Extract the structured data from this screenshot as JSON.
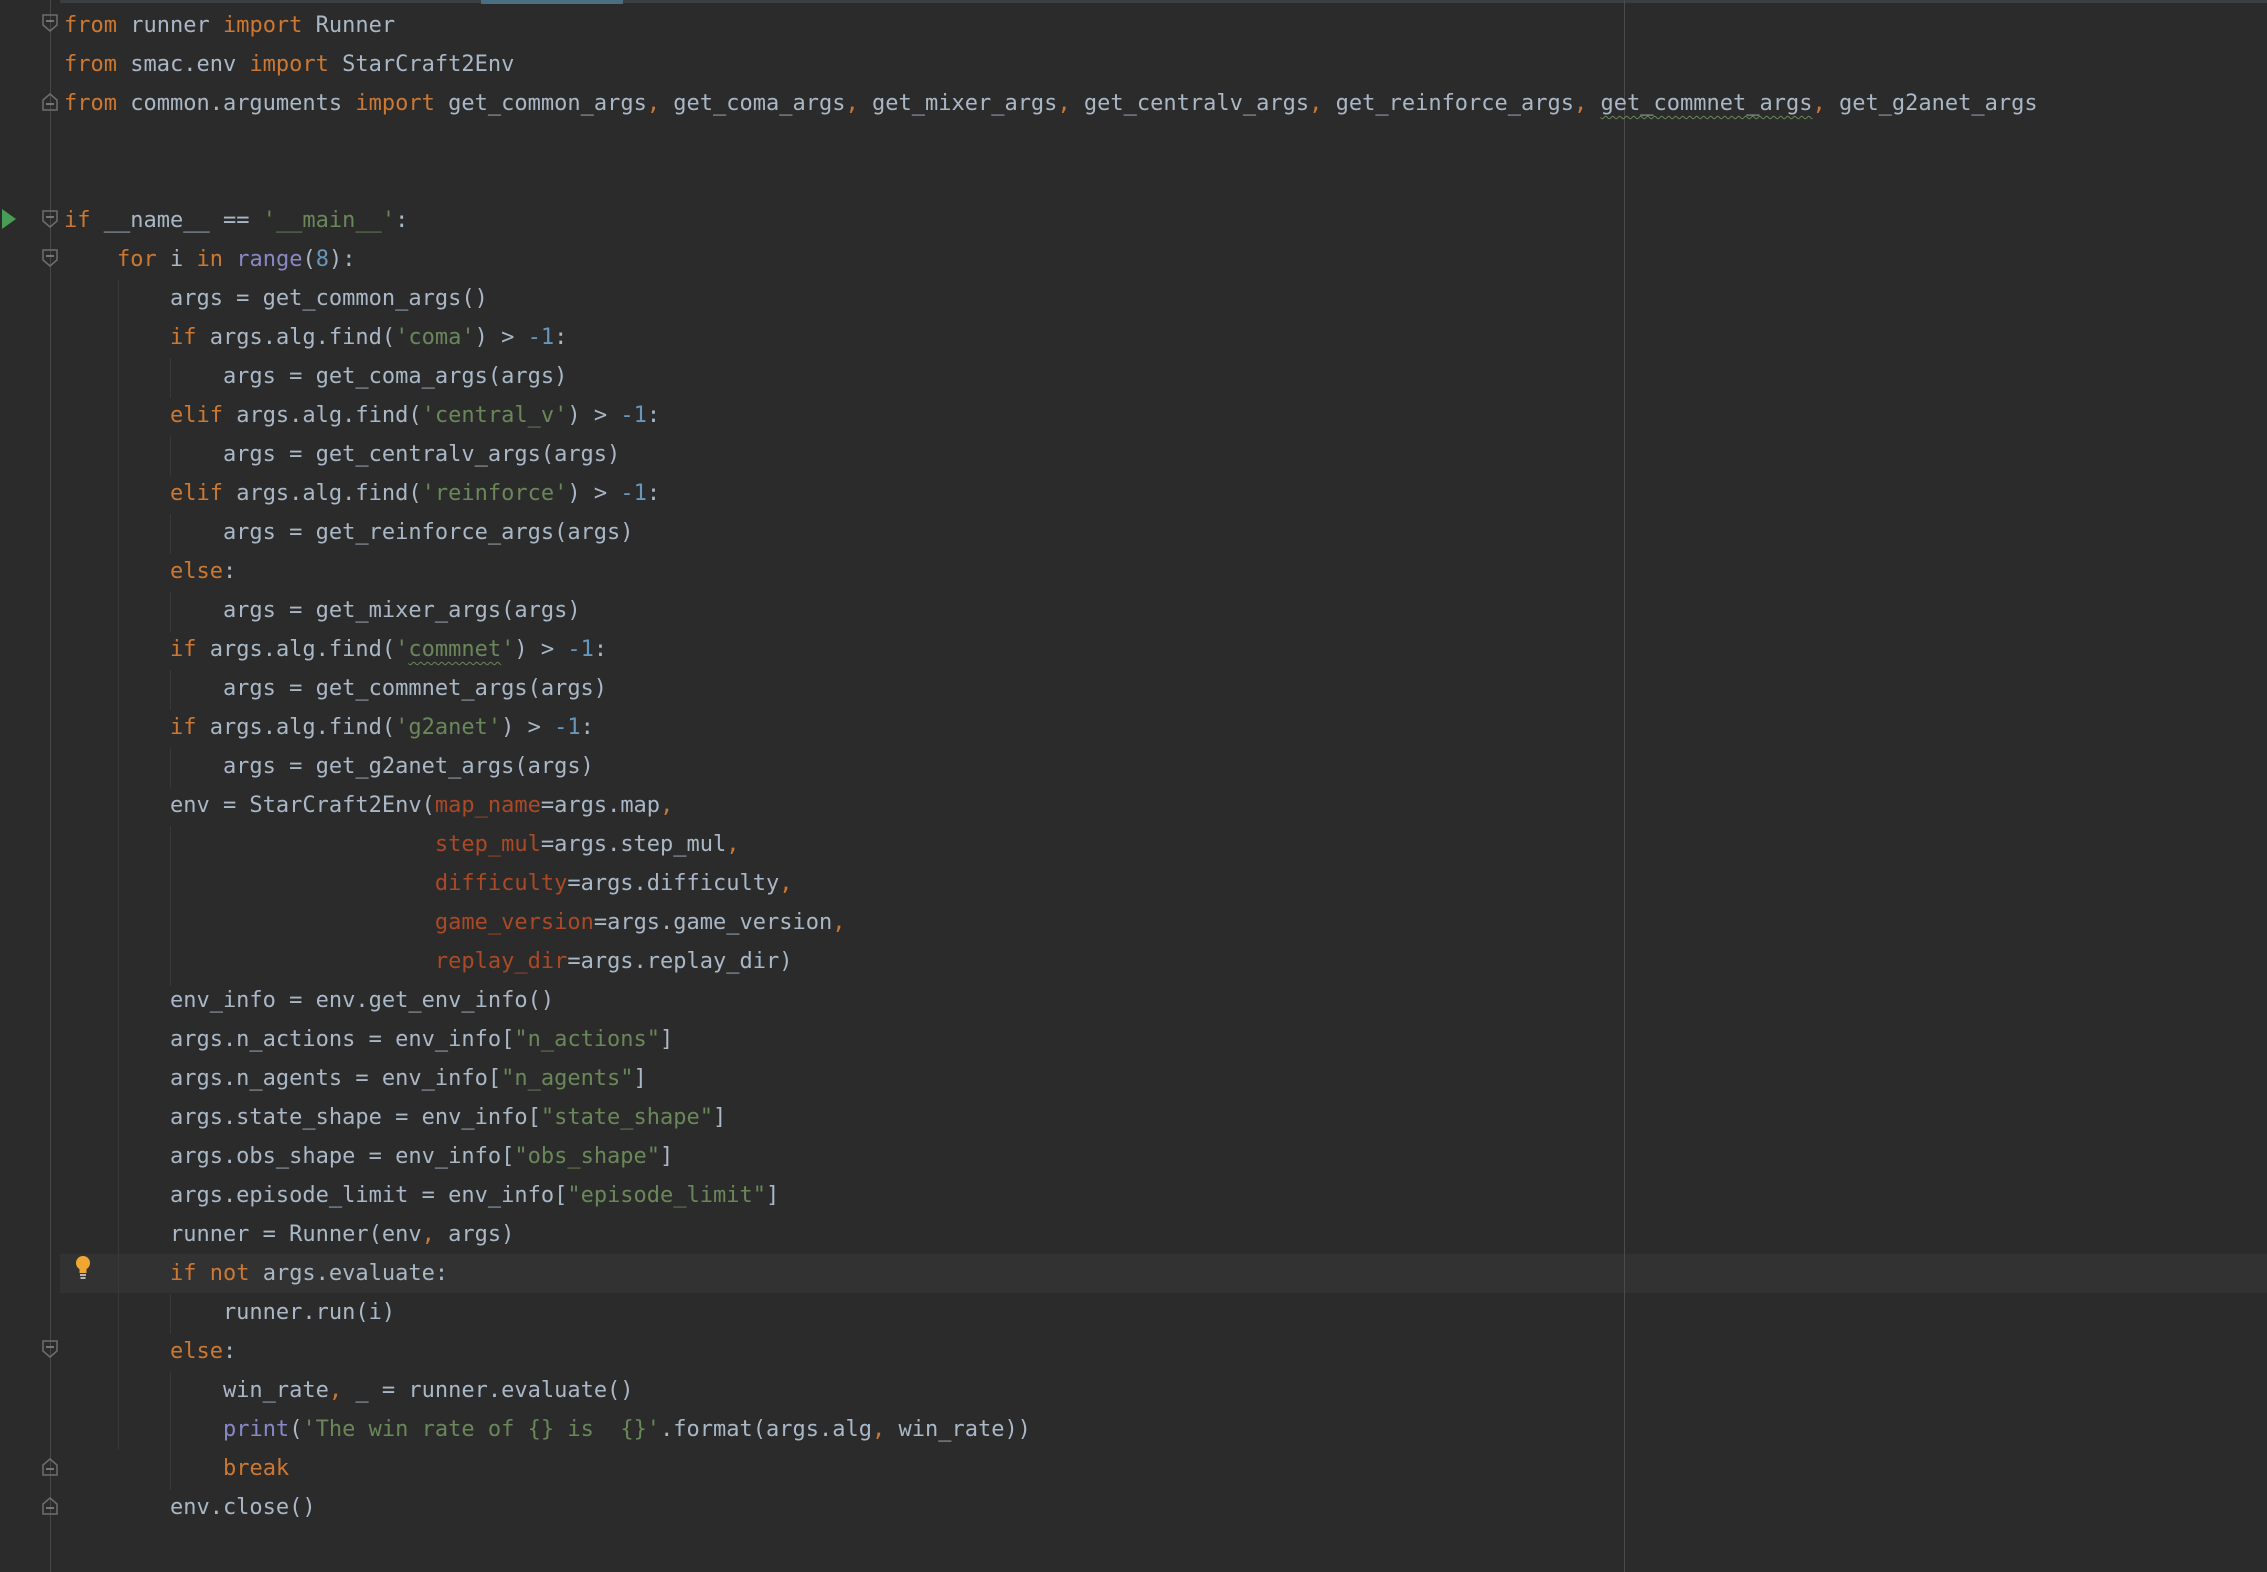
{
  "editor": {
    "language": "python",
    "colors": {
      "background": "#2b2b2b",
      "keyword": "#cc7832",
      "string": "#6a8759",
      "number": "#6897bb",
      "builtin": "#8888c6",
      "parameter": "#aa4926",
      "text": "#a9b7c6"
    },
    "lines": [
      [
        [
          "kw",
          "from"
        ],
        [
          "t",
          " runner "
        ],
        [
          "kw",
          "import"
        ],
        [
          "t",
          " Runner"
        ]
      ],
      [
        [
          "kw",
          "from"
        ],
        [
          "t",
          " smac.env "
        ],
        [
          "kw",
          "import"
        ],
        [
          "t",
          " StarCraft2Env"
        ]
      ],
      [
        [
          "kw",
          "from"
        ],
        [
          "t",
          " common.arguments "
        ],
        [
          "kw",
          "import"
        ],
        [
          "t",
          " get_common_args"
        ],
        [
          "p",
          ","
        ],
        [
          "t",
          " get_coma_args"
        ],
        [
          "p",
          ","
        ],
        [
          "t",
          " get_mixer_args"
        ],
        [
          "p",
          ","
        ],
        [
          "t",
          " get_centralv_args"
        ],
        [
          "p",
          ","
        ],
        [
          "t",
          " get_reinforce_args"
        ],
        [
          "p",
          ","
        ],
        [
          "t",
          " "
        ],
        [
          "typo",
          "get_commnet_args"
        ],
        [
          "p",
          ","
        ],
        [
          "t",
          " get_g2anet_args"
        ]
      ],
      [],
      [],
      [
        [
          "kw",
          "if"
        ],
        [
          "t",
          " __name__ == "
        ],
        [
          "str",
          "'__main__'"
        ],
        [
          "t",
          ":"
        ]
      ],
      [
        [
          "t",
          "    "
        ],
        [
          "kw",
          "for"
        ],
        [
          "t",
          " i "
        ],
        [
          "kw",
          "in"
        ],
        [
          "t",
          " "
        ],
        [
          "bi",
          "range"
        ],
        [
          "t",
          "("
        ],
        [
          "num",
          "8"
        ],
        [
          "t",
          "):"
        ]
      ],
      [
        [
          "t",
          "        args = get_common_args()"
        ]
      ],
      [
        [
          "t",
          "        "
        ],
        [
          "kw",
          "if"
        ],
        [
          "t",
          " args.alg.find("
        ],
        [
          "str",
          "'coma'"
        ],
        [
          "t",
          ") > "
        ],
        [
          "num",
          "-1"
        ],
        [
          "t",
          ":"
        ]
      ],
      [
        [
          "t",
          "            args = get_coma_args(args)"
        ]
      ],
      [
        [
          "t",
          "        "
        ],
        [
          "kw",
          "elif"
        ],
        [
          "t",
          " args.alg.find("
        ],
        [
          "str",
          "'central_v'"
        ],
        [
          "t",
          ") > "
        ],
        [
          "num",
          "-1"
        ],
        [
          "t",
          ":"
        ]
      ],
      [
        [
          "t",
          "            args = get_centralv_args(args)"
        ]
      ],
      [
        [
          "t",
          "        "
        ],
        [
          "kw",
          "elif"
        ],
        [
          "t",
          " args.alg.find("
        ],
        [
          "str",
          "'reinforce'"
        ],
        [
          "t",
          ") > "
        ],
        [
          "num",
          "-1"
        ],
        [
          "t",
          ":"
        ]
      ],
      [
        [
          "t",
          "            args = get_reinforce_args(args)"
        ]
      ],
      [
        [
          "t",
          "        "
        ],
        [
          "kw",
          "else"
        ],
        [
          "t",
          ":"
        ]
      ],
      [
        [
          "t",
          "            args = get_mixer_args(args)"
        ]
      ],
      [
        [
          "t",
          "        "
        ],
        [
          "kw",
          "if"
        ],
        [
          "t",
          " args.alg.find("
        ],
        [
          "str",
          "'"
        ],
        [
          "typo",
          "commnet"
        ],
        [
          "str",
          "'"
        ],
        [
          "t",
          ") > "
        ],
        [
          "num",
          "-1"
        ],
        [
          "t",
          ":"
        ]
      ],
      [
        [
          "t",
          "            args = get_commnet_args(args)"
        ]
      ],
      [
        [
          "t",
          "        "
        ],
        [
          "kw",
          "if"
        ],
        [
          "t",
          " args.alg.find("
        ],
        [
          "str",
          "'g2anet'"
        ],
        [
          "t",
          ") > "
        ],
        [
          "num",
          "-1"
        ],
        [
          "t",
          ":"
        ]
      ],
      [
        [
          "t",
          "            args = get_g2anet_args(args)"
        ]
      ],
      [
        [
          "t",
          "        env = StarCraft2Env("
        ],
        [
          "param",
          "map_name"
        ],
        [
          "t",
          "=args.map"
        ],
        [
          "p",
          ","
        ]
      ],
      [
        [
          "t",
          "                            "
        ],
        [
          "param",
          "step_mul"
        ],
        [
          "t",
          "=args.step_mul"
        ],
        [
          "p",
          ","
        ]
      ],
      [
        [
          "t",
          "                            "
        ],
        [
          "param",
          "difficulty"
        ],
        [
          "t",
          "=args.difficulty"
        ],
        [
          "p",
          ","
        ]
      ],
      [
        [
          "t",
          "                            "
        ],
        [
          "param",
          "game_version"
        ],
        [
          "t",
          "=args.game_version"
        ],
        [
          "p",
          ","
        ]
      ],
      [
        [
          "t",
          "                            "
        ],
        [
          "param",
          "replay_dir"
        ],
        [
          "t",
          "=args.replay_dir)"
        ]
      ],
      [
        [
          "t",
          "        env_info = env.get_env_info()"
        ]
      ],
      [
        [
          "t",
          "        args.n_actions = env_info["
        ],
        [
          "str",
          "\"n_actions\""
        ],
        [
          "t",
          "]"
        ]
      ],
      [
        [
          "t",
          "        args.n_agents = env_info["
        ],
        [
          "str",
          "\"n_agents\""
        ],
        [
          "t",
          "]"
        ]
      ],
      [
        [
          "t",
          "        args.state_shape = env_info["
        ],
        [
          "str",
          "\"state_shape\""
        ],
        [
          "t",
          "]"
        ]
      ],
      [
        [
          "t",
          "        args.obs_shape = env_info["
        ],
        [
          "str",
          "\"obs_shape\""
        ],
        [
          "t",
          "]"
        ]
      ],
      [
        [
          "t",
          "        args.episode_limit = env_info["
        ],
        [
          "str",
          "\"episode_limit\""
        ],
        [
          "t",
          "]"
        ]
      ],
      [
        [
          "t",
          "        runner = Runner(env"
        ],
        [
          "p",
          ","
        ],
        [
          "t",
          " args)"
        ]
      ],
      [
        [
          "t",
          "        "
        ],
        [
          "kw",
          "if not"
        ],
        [
          "t",
          " args.evaluate:"
        ]
      ],
      [
        [
          "t",
          "            runner.run(i)"
        ]
      ],
      [
        [
          "t",
          "        "
        ],
        [
          "kw",
          "else"
        ],
        [
          "t",
          ":"
        ]
      ],
      [
        [
          "t",
          "            win_rate"
        ],
        [
          "p",
          ","
        ],
        [
          "t",
          " _ = runner.evaluate()"
        ]
      ],
      [
        [
          "t",
          "            "
        ],
        [
          "bi",
          "print"
        ],
        [
          "t",
          "("
        ],
        [
          "str",
          "'The win rate of {} is  {}'"
        ],
        [
          "t",
          ".format(args.alg"
        ],
        [
          "p",
          ","
        ],
        [
          "t",
          " win_rate))"
        ]
      ],
      [
        [
          "t",
          "            "
        ],
        [
          "kw",
          "break"
        ]
      ],
      [
        [
          "t",
          "        env.close()"
        ]
      ]
    ]
  },
  "gutter": {
    "run_icon": "run-arrow-icon",
    "intention_icon": "lightbulb-icon",
    "fold_icon": "fold-marker-icon"
  }
}
